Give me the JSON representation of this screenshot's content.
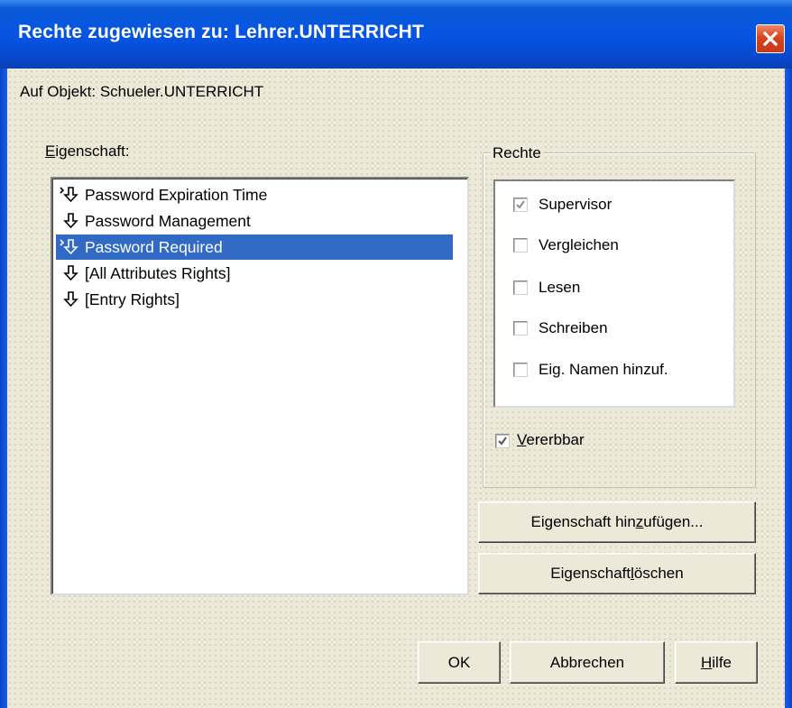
{
  "window": {
    "title": "Rechte zugewiesen zu: Lehrer.UNTERRICHT",
    "close_icon": "close-icon"
  },
  "object_label": "Auf Objekt: Schueler.UNTERRICHT",
  "properties": {
    "label_first": "E",
    "label_rest": "igenschaft:",
    "items": [
      {
        "label": "Password Expiration Time",
        "icon": "inherit-arrow-icon",
        "selected": false
      },
      {
        "label": "Password Management",
        "icon": "down-arrow-icon",
        "selected": false
      },
      {
        "label": "Password Required",
        "icon": "inherit-arrow-icon",
        "selected": true
      },
      {
        "label": "[All Attributes Rights]",
        "icon": "down-arrow-icon",
        "selected": false
      },
      {
        "label": "[Entry Rights]",
        "icon": "down-arrow-icon",
        "selected": false
      }
    ]
  },
  "rights": {
    "group_label": "Rechte",
    "items": [
      {
        "label": "Supervisor",
        "checked": true
      },
      {
        "label": "Vergleichen",
        "checked": false
      },
      {
        "label": "Lesen",
        "checked": false
      },
      {
        "label": "Schreiben",
        "checked": false
      },
      {
        "label": "Eig. Namen hinzuf.",
        "checked": false
      }
    ],
    "inheritable": {
      "label_first": "V",
      "label_rest": "ererbbar",
      "checked": true
    }
  },
  "buttons": {
    "add_property": {
      "before": "Eigenschaft hin",
      "accel": "z",
      "after": "ufügen..."
    },
    "delete_property": {
      "before": "Eigenschaft ",
      "accel": "l",
      "after": "öschen"
    },
    "ok": "OK",
    "cancel": "Abbrechen",
    "help": {
      "accel": "H",
      "after": "ilfe"
    }
  }
}
